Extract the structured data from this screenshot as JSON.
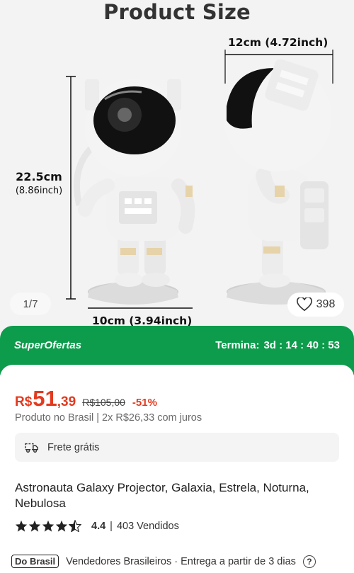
{
  "gallery": {
    "title": "Product Size",
    "width_label": "12cm (4.72inch)",
    "height_label": "22.5cm",
    "height_label_inch": "(8.86inch)",
    "base_label": "10cm (3.94inch)",
    "counter": "1/7",
    "likes": "398"
  },
  "deal": {
    "brand": "SuperOfertas",
    "ends_label": "Termina:",
    "countdown": "3d : 14 : 40 : 53"
  },
  "price": {
    "currency": "R$",
    "integer": "51",
    "cents": ",39",
    "old_price": "R$105,00",
    "discount": "-51%",
    "sub": "Produto no Brasil | 2x R$26,33 com juros"
  },
  "shipping": {
    "label": "Frete grátis",
    "icon": "truck-icon"
  },
  "product": {
    "title": "Astronauta Galaxy Projector, Galaxia, Estrela, Noturna, Nebulosa",
    "rating": "4.4",
    "rating_value": 4.4,
    "sold": "403 Vendidos"
  },
  "seller": {
    "badge": "Do Brasil",
    "text": "Vendedores Brasileiros · Entrega a partir de 3 dias",
    "help": "?"
  },
  "colors": {
    "accent_green": "#0d9b4c",
    "price_red": "#e33a1f"
  }
}
